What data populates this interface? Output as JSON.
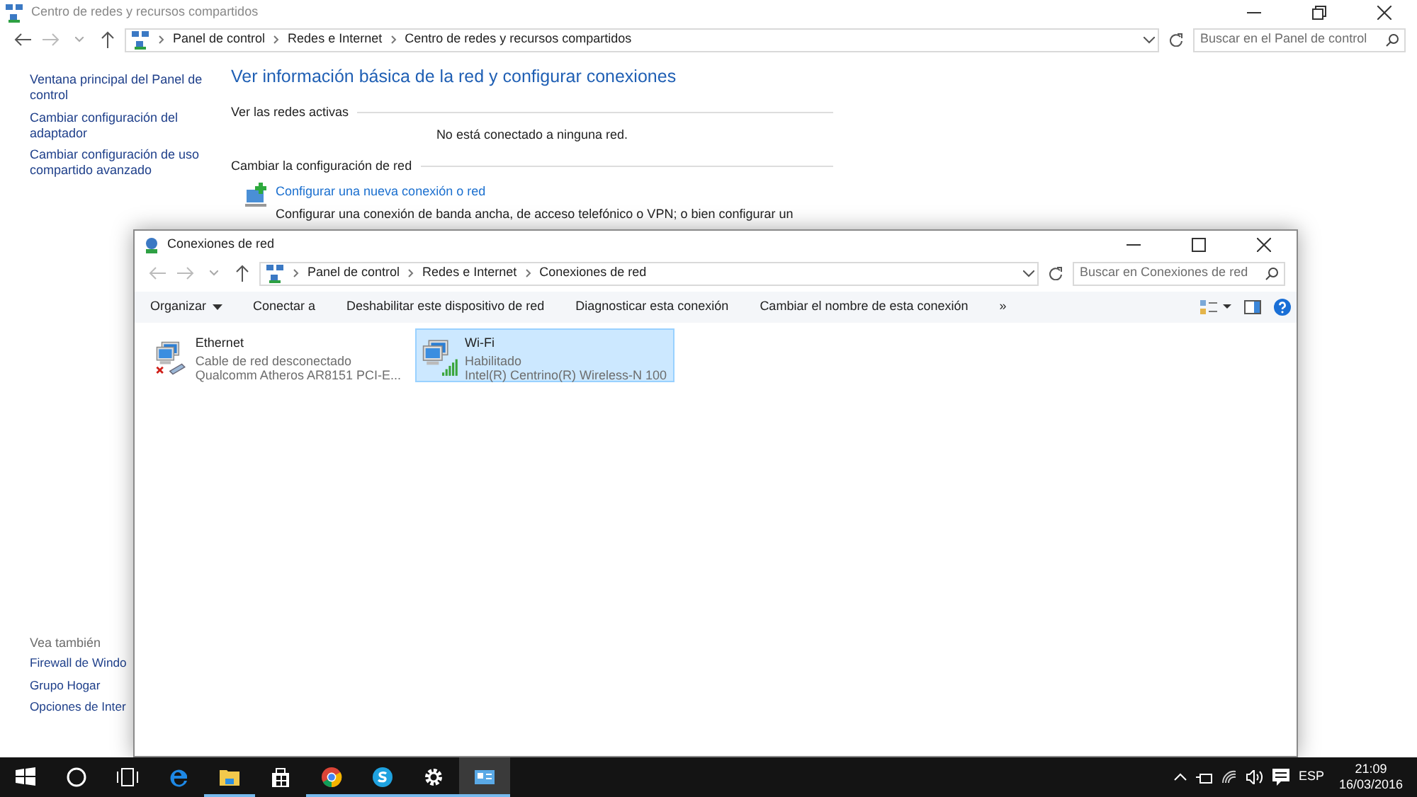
{
  "back_window": {
    "title": "Centro de redes y recursos compartidos",
    "breadcrumb": [
      "Panel de control",
      "Redes e Internet",
      "Centro de redes y recursos compartidos"
    ],
    "search": {
      "placeholder": "Buscar en el Panel de control"
    },
    "sidebar": {
      "links": [
        "Ventana principal del Panel de control",
        "Cambiar configuración del adaptador",
        "Cambiar configuración de uso compartido avanzado"
      ],
      "see_also_title": "Vea también",
      "see_also": [
        "Firewall de Windo",
        "Grupo Hogar",
        "Opciones de Inter"
      ]
    },
    "heading": "Ver información básica de la red y configurar conexiones",
    "active_networks": {
      "title": "Ver las redes activas",
      "message": "No está conectado a ninguna red."
    },
    "change_settings": {
      "title": "Cambiar la configuración de red",
      "link": "Configurar una nueva conexión o red",
      "description": "Configurar una conexión de banda ancha, de acceso telefónico o VPN; o bien configurar un"
    }
  },
  "front_window": {
    "title": "Conexiones de red",
    "breadcrumb": [
      "Panel de control",
      "Redes e Internet",
      "Conexiones de red"
    ],
    "search": {
      "placeholder": "Buscar en Conexiones de red"
    },
    "toolbar": [
      {
        "label": "Organizar",
        "kind": "menu"
      },
      {
        "label": "Conectar a",
        "kind": "command"
      },
      {
        "label": "Deshabilitar este dispositivo de red",
        "kind": "command"
      },
      {
        "label": "Diagnosticar esta conexión",
        "kind": "command"
      },
      {
        "label": "Cambiar el nombre de esta conexión",
        "kind": "command"
      },
      {
        "label": "»",
        "kind": "command"
      }
    ],
    "connections": [
      {
        "name": "Ethernet",
        "status": "Cable de red desconectado",
        "adapter": "Qualcomm Atheros AR8151 PCI-E...",
        "kind": "cable",
        "selected": false
      },
      {
        "name": "Wi-Fi",
        "status": "Habilitado",
        "adapter": "Intel(R) Centrino(R) Wireless-N 100",
        "kind": "wifi",
        "selected": true
      }
    ]
  },
  "taskbar": {
    "apps": [
      {
        "running": false,
        "selected": false
      },
      {
        "running": false,
        "selected": false
      },
      {
        "running": false,
        "selected": false
      },
      {
        "running": false,
        "selected": false
      },
      {
        "running": true,
        "selected": false
      },
      {
        "running": false,
        "selected": false
      },
      {
        "running": true,
        "selected": false
      },
      {
        "running": true,
        "selected": false
      },
      {
        "running": true,
        "selected": false
      },
      {
        "running": true,
        "selected": true
      }
    ],
    "language": "ESP",
    "time": "21:09",
    "date": "16/03/2016"
  }
}
